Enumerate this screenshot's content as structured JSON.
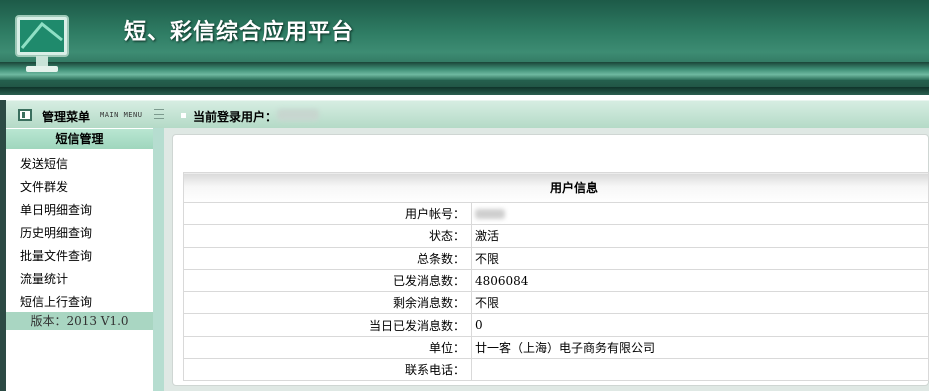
{
  "header": {
    "title": "短、彩信综合应用平台"
  },
  "menubar": {
    "menu_title": "管理菜单",
    "menu_subtitle": "MAIN MENU",
    "current_user_label": "当前登录用户："
  },
  "sidebar": {
    "section_title": "短信管理",
    "items": [
      {
        "label": "发送短信"
      },
      {
        "label": "文件群发"
      },
      {
        "label": "单日明细查询"
      },
      {
        "label": "历史明细查询"
      },
      {
        "label": "批量文件查询"
      },
      {
        "label": "流量统计"
      },
      {
        "label": "短信上行查询"
      }
    ],
    "version": "版本：2013 V1.0"
  },
  "user_info": {
    "title": "用户信息",
    "rows": [
      {
        "label": "用户帐号：",
        "value": ""
      },
      {
        "label": "状态：",
        "value": "激活"
      },
      {
        "label": "总条数：",
        "value": "不限"
      },
      {
        "label": "已发消息数：",
        "value": "4806084"
      },
      {
        "label": "剩余消息数：",
        "value": "不限"
      },
      {
        "label": "当日已发消息数：",
        "value": "0"
      },
      {
        "label": "单位：",
        "value": "廿一客（上海）电子商务有限公司"
      },
      {
        "label": "联系电话：",
        "value": ""
      }
    ]
  }
}
